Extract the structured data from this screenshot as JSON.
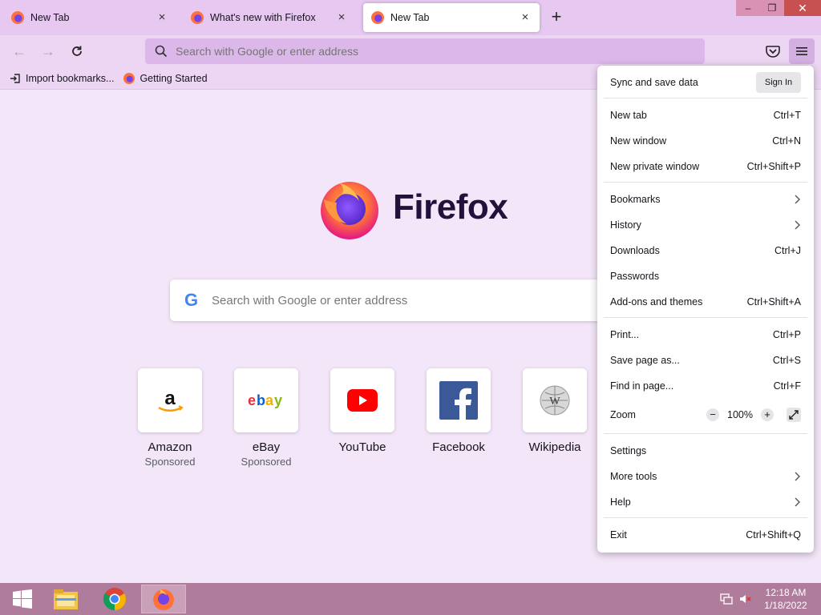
{
  "tabs": [
    {
      "title": "New Tab",
      "active": false
    },
    {
      "title": "What's new with Firefox",
      "active": false
    },
    {
      "title": "New Tab",
      "active": true
    }
  ],
  "window_controls": {
    "minimize": "–",
    "restore": "❐",
    "close": "✕"
  },
  "navbar": {
    "back_icon": "arrow-left-icon",
    "forward_icon": "arrow-right-icon",
    "reload_icon": "reload-icon",
    "url_placeholder": "Search with Google or enter address"
  },
  "bookmarks": [
    {
      "label": "Import bookmarks...",
      "icon": "import-icon"
    },
    {
      "label": "Getting Started",
      "icon": "firefox-icon"
    }
  ],
  "newtab": {
    "logo_text": "Firefox",
    "search_placeholder": "Search with Google or enter address",
    "search_g": "G",
    "tiles": [
      {
        "name": "Amazon",
        "sponsor": "Sponsored"
      },
      {
        "name": "eBay",
        "sponsor": "Sponsored"
      },
      {
        "name": "YouTube",
        "sponsor": ""
      },
      {
        "name": "Facebook",
        "sponsor": ""
      },
      {
        "name": "Wikipedia",
        "sponsor": ""
      }
    ]
  },
  "app_menu": {
    "sync_label": "Sync and save data",
    "signin_label": "Sign In",
    "items": {
      "new_tab": {
        "label": "New tab",
        "shortcut": "Ctrl+T"
      },
      "new_window": {
        "label": "New window",
        "shortcut": "Ctrl+N"
      },
      "new_private": {
        "label": "New private window",
        "shortcut": "Ctrl+Shift+P"
      },
      "bookmarks": {
        "label": "Bookmarks"
      },
      "history": {
        "label": "History"
      },
      "downloads": {
        "label": "Downloads",
        "shortcut": "Ctrl+J"
      },
      "passwords": {
        "label": "Passwords"
      },
      "addons": {
        "label": "Add-ons and themes",
        "shortcut": "Ctrl+Shift+A"
      },
      "print": {
        "label": "Print...",
        "shortcut": "Ctrl+P"
      },
      "save_page": {
        "label": "Save page as...",
        "shortcut": "Ctrl+S"
      },
      "find": {
        "label": "Find in page...",
        "shortcut": "Ctrl+F"
      },
      "zoom": {
        "label": "Zoom",
        "value": "100%",
        "minus": "−",
        "plus": "+"
      },
      "settings": {
        "label": "Settings"
      },
      "more_tools": {
        "label": "More tools"
      },
      "help": {
        "label": "Help"
      },
      "exit": {
        "label": "Exit",
        "shortcut": "Ctrl+Shift+Q"
      }
    }
  },
  "taskbar": {
    "apps": [
      "start-icon",
      "file-explorer-icon",
      "chrome-icon",
      "firefox-icon"
    ],
    "time": "12:18 AM",
    "date": "1/18/2022"
  },
  "colors": {
    "tab_strip": "#e6c8f0",
    "accent_orange": "#ff7139",
    "accent_purple": "#7542e5",
    "taskbar": "#b07c9c"
  }
}
